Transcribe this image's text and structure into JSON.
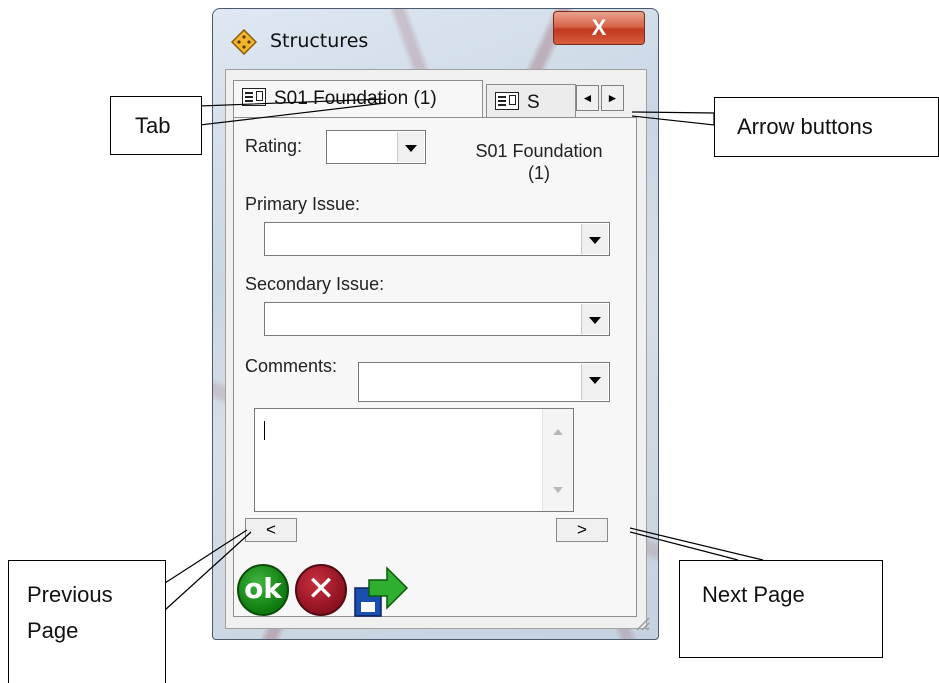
{
  "window": {
    "title": "Structures",
    "close_label": "X"
  },
  "tabs": [
    {
      "label": "S01 Foundation (1)"
    },
    {
      "label": "S"
    }
  ],
  "tab_scroll": {
    "left": "◄",
    "right": "►"
  },
  "form": {
    "rating_label": "Rating:",
    "rating_value": "",
    "section_title_line1": "S01 Foundation",
    "section_title_line2": "(1)",
    "primary_issue_label": "Primary Issue:",
    "primary_issue_value": "",
    "secondary_issue_label": "Secondary Issue:",
    "secondary_issue_value": "",
    "comments_label": "Comments:",
    "comments_value": "",
    "comments_text": ""
  },
  "paging": {
    "prev_label": "<",
    "next_label": ">"
  },
  "actions": {
    "ok_label": "ok",
    "cancel_label": "✕"
  },
  "annotations": {
    "tab": "Tab",
    "arrow_buttons": "Arrow buttons",
    "previous_page_line1": "Previous",
    "previous_page_line2": "Page",
    "next_page": "Next Page"
  },
  "colors": {
    "ok_green": "#0d7a0d",
    "cancel_red": "#8d1020",
    "close_red": "#c0391f",
    "arrow_green": "#2fae2f",
    "arrow_blue": "#1a4fb0"
  }
}
